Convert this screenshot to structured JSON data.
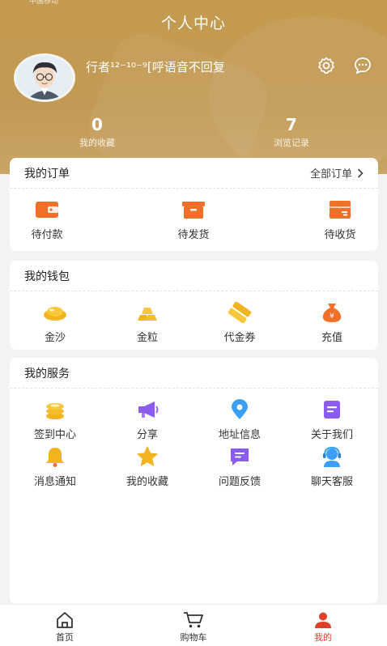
{
  "status_bar": {
    "carrier": "中国移动"
  },
  "header": {
    "title": "个人中心",
    "username": "行者¹²⁻¹⁰⁻⁹[呼语音不回复",
    "icons": [
      "settings-icon",
      "message-icon"
    ],
    "stats": [
      {
        "value": "0",
        "label": "我的收藏"
      },
      {
        "value": "7",
        "label": "浏览记录"
      }
    ]
  },
  "orders": {
    "title": "我的订单",
    "all_label": "全部订单",
    "items": [
      {
        "label": "待付款",
        "icon": "wallet-icon"
      },
      {
        "label": "待发货",
        "icon": "box-icon"
      },
      {
        "label": "待收货",
        "icon": "package-icon"
      }
    ]
  },
  "wallet": {
    "title": "我的钱包",
    "items": [
      {
        "label": "金沙",
        "icon": "gold-sand-icon"
      },
      {
        "label": "金粒",
        "icon": "gold-bars-icon"
      },
      {
        "label": "代金券",
        "icon": "coupon-icon"
      },
      {
        "label": "充值",
        "icon": "money-bag-icon"
      }
    ]
  },
  "services": {
    "title": "我的服务",
    "items": [
      {
        "label": "签到中心",
        "icon": "coins-icon"
      },
      {
        "label": "分享",
        "icon": "megaphone-icon"
      },
      {
        "label": "地址信息",
        "icon": "location-icon"
      },
      {
        "label": "关于我们",
        "icon": "document-icon"
      },
      {
        "label": "消息通知",
        "icon": "bell-icon"
      },
      {
        "label": "我的收藏",
        "icon": "star-icon"
      },
      {
        "label": "问题反馈",
        "icon": "feedback-icon"
      },
      {
        "label": "聊天客服",
        "icon": "customer-service-icon"
      }
    ]
  },
  "tabbar": {
    "items": [
      {
        "label": "首页",
        "icon": "home-icon"
      },
      {
        "label": "购物车",
        "icon": "cart-icon"
      },
      {
        "label": "我的",
        "icon": "user-icon",
        "active": true
      }
    ]
  },
  "colors": {
    "header": "#c49a4e",
    "accent": "#e0402a",
    "orange": "#f0702a",
    "gold": "#f2b320",
    "purple": "#8a5cf0",
    "blue": "#3a9ff5"
  }
}
